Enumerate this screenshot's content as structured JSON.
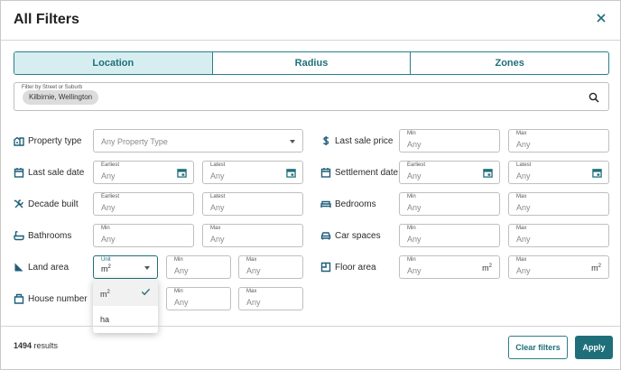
{
  "dialog": {
    "title": "All Filters"
  },
  "tabs": [
    {
      "label": "Location",
      "active": true
    },
    {
      "label": "Radius",
      "active": false
    },
    {
      "label": "Zones",
      "active": false
    }
  ],
  "search": {
    "label": "Filter by Street or Suburb",
    "chip": "Kilbirnie, Wellington"
  },
  "filters": {
    "property_type": {
      "label": "Property type",
      "placeholder": "Any Property Type",
      "icon": "house-icon"
    },
    "last_sale_price": {
      "label": "Last sale price",
      "min_label": "Min",
      "max_label": "Max",
      "min": "Any",
      "max": "Any",
      "icon": "dollar-icon"
    },
    "last_sale_date": {
      "label": "Last sale date",
      "earliest_label": "Earliest",
      "latest_label": "Latest",
      "earliest": "Any",
      "latest": "Any",
      "icon": "calendar-icon"
    },
    "settlement_date": {
      "label": "Settlement date",
      "earliest_label": "Earliest",
      "latest_label": "Latest",
      "earliest": "Any",
      "latest": "Any",
      "icon": "calendar-icon"
    },
    "decade_built": {
      "label": "Decade built",
      "earliest_label": "Earliest",
      "latest_label": "Latest",
      "earliest": "Any",
      "latest": "Any",
      "icon": "tools-icon"
    },
    "bedrooms": {
      "label": "Bedrooms",
      "min_label": "Min",
      "max_label": "Max",
      "min": "Any",
      "max": "Any",
      "icon": "bed-icon"
    },
    "bathrooms": {
      "label": "Bathrooms",
      "min_label": "Min",
      "max_label": "Max",
      "min": "Any",
      "max": "Any",
      "icon": "bath-icon"
    },
    "car_spaces": {
      "label": "Car spaces",
      "min_label": "Min",
      "max_label": "Max",
      "min": "Any",
      "max": "Any",
      "icon": "car-icon"
    },
    "land_area": {
      "label": "Land area",
      "unit_label": "Unit",
      "unit": "m",
      "unit_sup": "2",
      "min_label": "Min",
      "max_label": "Max",
      "min": "Any",
      "max": "Any",
      "icon": "area-icon"
    },
    "floor_area": {
      "label": "Floor area",
      "min_label": "Min",
      "max_label": "Max",
      "min": "Any",
      "max": "Any",
      "unit": "m",
      "unit_sup": "2",
      "icon": "floorplan-icon"
    },
    "house_number": {
      "label": "House number",
      "min_label": "Min",
      "max_label": "Max",
      "min": "Any",
      "max": "Any",
      "icon": "door-icon"
    }
  },
  "unit_dropdown": {
    "options": [
      {
        "label": "m",
        "sup": "2",
        "selected": true
      },
      {
        "label": "ha",
        "sup": "",
        "selected": false
      }
    ]
  },
  "footer": {
    "count": "1494",
    "count_suffix": " results",
    "clear_label": "Clear filters",
    "apply_label": "Apply"
  },
  "colors": {
    "accent": "#1f6f7a",
    "tab_active_bg": "#d7eef1",
    "icon": "#1f5e7a"
  }
}
